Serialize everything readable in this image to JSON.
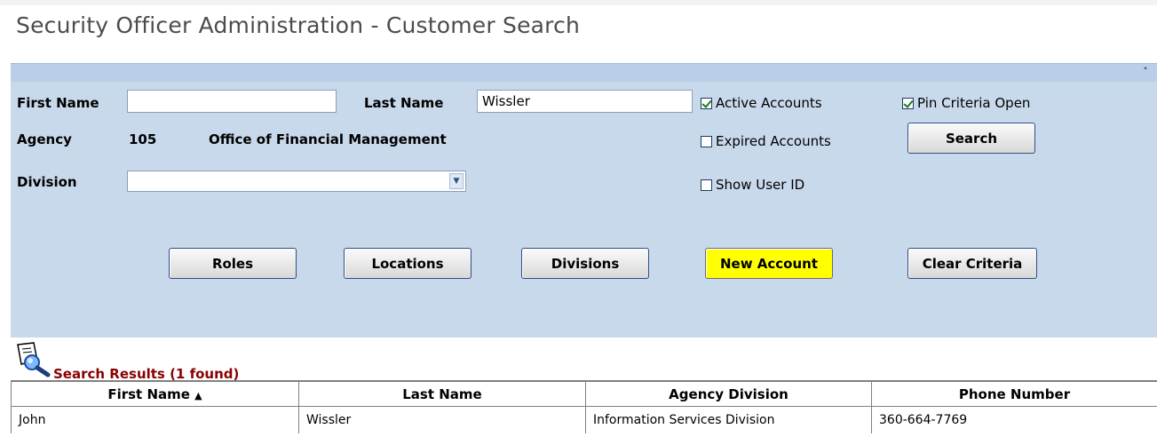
{
  "page": {
    "title": "Security Officer Administration - Customer Search"
  },
  "criteria": {
    "first_name_label": "First Name",
    "first_name_value": "",
    "last_name_label": "Last Name",
    "last_name_value": "Wissler",
    "agency_label": "Agency",
    "agency_code": "105",
    "agency_name": "Office of Financial Management",
    "division_label": "Division",
    "division_value": "",
    "active_accounts_label": "Active Accounts",
    "active_accounts_checked": true,
    "expired_accounts_label": "Expired Accounts",
    "expired_accounts_checked": false,
    "show_user_id_label": "Show User ID",
    "show_user_id_checked": false,
    "pin_criteria_label": "Pin Criteria Open",
    "pin_criteria_checked": true,
    "search_button": "Search",
    "collapse_icon": "double-chevron-up-icon"
  },
  "actions": {
    "roles": "Roles",
    "locations": "Locations",
    "divisions": "Divisions",
    "new_account": "New Account",
    "clear_criteria": "Clear Criteria",
    "new_account_color": "#ffff00"
  },
  "results": {
    "title": "Search Results (1 found)",
    "icon": "magnifier-document-icon",
    "columns": [
      "First Name",
      "Last Name",
      "Agency Division",
      "Phone Number"
    ],
    "sorted_column": "First Name",
    "sort_direction": "ascending",
    "rows": [
      [
        "John",
        "Wissler",
        "Information Services Division",
        "360-664-7769"
      ]
    ]
  },
  "colors": {
    "panel_bg": "#c9d9ec",
    "results_title": "#8b0000",
    "page_title": "#4c4c4c"
  }
}
